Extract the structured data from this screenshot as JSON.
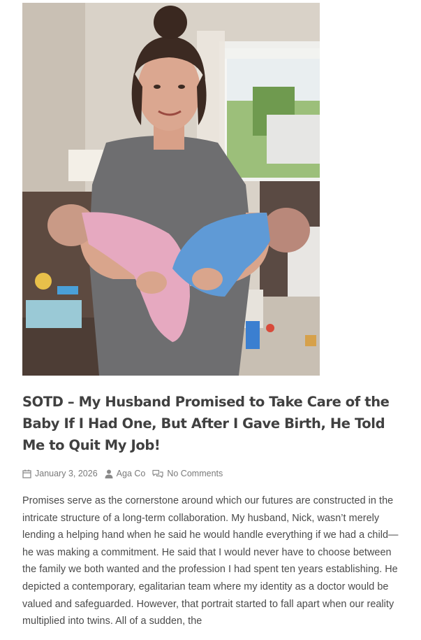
{
  "article": {
    "title": "SOTD – My Husband Promised to Take Care of the Baby If I Had One, But After I Gave Birth, He Told Me to Quit My Job!",
    "meta": {
      "date": "January 3, 2026",
      "author": "Aga Co",
      "comments": "No Comments"
    },
    "body": "Promises serve as the cornerstone around which our futures are constructed in the intricate structure of a long-term collaboration. My husband, Nick, wasn’t merely lending a helping hand when he said he would handle everything if we had a child—he was making a commitment. He said that I would never have to choose between the family we both wanted and the profession I had spent ten years establishing. He depicted a contemporary, egalitarian team where my identity as a doctor would be valued and safeguarded. However, that portrait started to fall apart when our reality multiplied into twins. All of a sudden, the"
  },
  "icons": {
    "date": "calendar-icon",
    "author": "user-icon",
    "comments": "comments-icon"
  },
  "colors": {
    "title": "#404040",
    "meta": "#7a7a7a",
    "body": "#4a4a4a"
  }
}
